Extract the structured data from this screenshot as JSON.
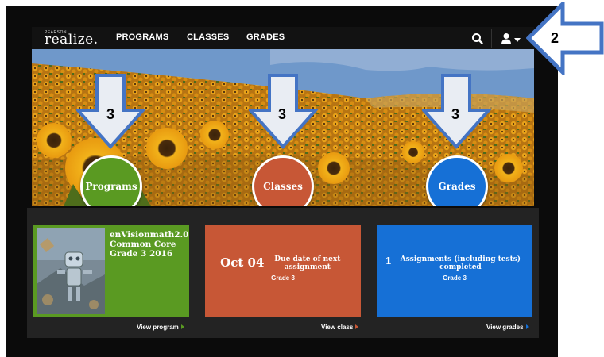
{
  "navbar": {
    "logo_small": "PEARSON",
    "logo_big": "realize.",
    "links": [
      "PROGRAMS",
      "CLASSES",
      "GRADES"
    ],
    "search_icon": "search-icon",
    "user_icon": "user-icon",
    "caret_icon": "caret-down-icon"
  },
  "hero": {
    "programs": "Programs",
    "classes": "Classes",
    "grades": "Grades"
  },
  "annotations": {
    "user_menu": "2",
    "circle_1": "3",
    "circle_2": "3",
    "circle_3": "3"
  },
  "cards": {
    "program": {
      "title": "enVisionmath2.0 Common Core Grade 3 2016",
      "link": "View program"
    },
    "class": {
      "date": "Oct 04",
      "label": "Due date of next assignment",
      "grade": "Grade 3",
      "link": "View class"
    },
    "grades": {
      "count": "1",
      "label": "Assignments (including tests) completed",
      "grade": "Grade 3",
      "link": "View grades"
    }
  },
  "colors": {
    "programs": "#5a9a22",
    "classes": "#c75736",
    "grades": "#1670d6",
    "arrow_fill": "#e9edf3",
    "arrow_stroke": "#4474c4"
  }
}
